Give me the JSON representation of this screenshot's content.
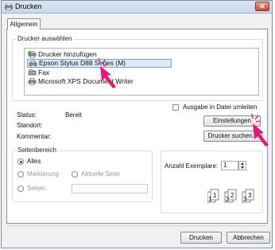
{
  "window": {
    "title": "Drucken",
    "close_label": "✕"
  },
  "tabs": [
    {
      "label": "Allgemein",
      "selected": true
    }
  ],
  "printer_group": {
    "legend": "Drucker auswählen",
    "printers": [
      {
        "label": "Drucker hinzufügen",
        "icon": "add-printer-icon",
        "selected": false
      },
      {
        "label": "Epson Stylus D88 Series (M)",
        "icon": "printer-icon",
        "selected": true
      },
      {
        "label": "Fax",
        "icon": "fax-icon",
        "selected": false
      },
      {
        "label": "Microsoft XPS Document Writer",
        "icon": "printer-icon",
        "selected": false
      }
    ],
    "status_label": "Status:",
    "status_value": "Bereit",
    "location_label": "Standort:",
    "comment_label": "Kommentar:",
    "print_to_file_label": "Ausgabe in Datei umleiten",
    "print_to_file_checked": false,
    "preferences_button": "Einstellungen",
    "find_printer_button": "Drucker suchen..."
  },
  "page_range": {
    "legend": "Seitenbereich",
    "options": [
      {
        "label": "Alles",
        "checked": true,
        "enabled": true
      },
      {
        "label": "Markierung",
        "checked": false,
        "enabled": false
      },
      {
        "label": "Aktuelle Seite",
        "checked": false,
        "enabled": false
      },
      {
        "label": "Seiten:",
        "checked": false,
        "enabled": false
      }
    ],
    "pages_value": ""
  },
  "copies": {
    "label": "Anzahl Exemplare:",
    "value": "1",
    "collate_pages": [
      "1",
      "1",
      "2",
      "2",
      "3",
      "3"
    ]
  },
  "footer": {
    "print_button": "Drucken",
    "cancel_button": "Abbrechen"
  },
  "colors": {
    "accent": "#e8177a",
    "selection": "#dce9f8",
    "close": "#c9452f"
  }
}
